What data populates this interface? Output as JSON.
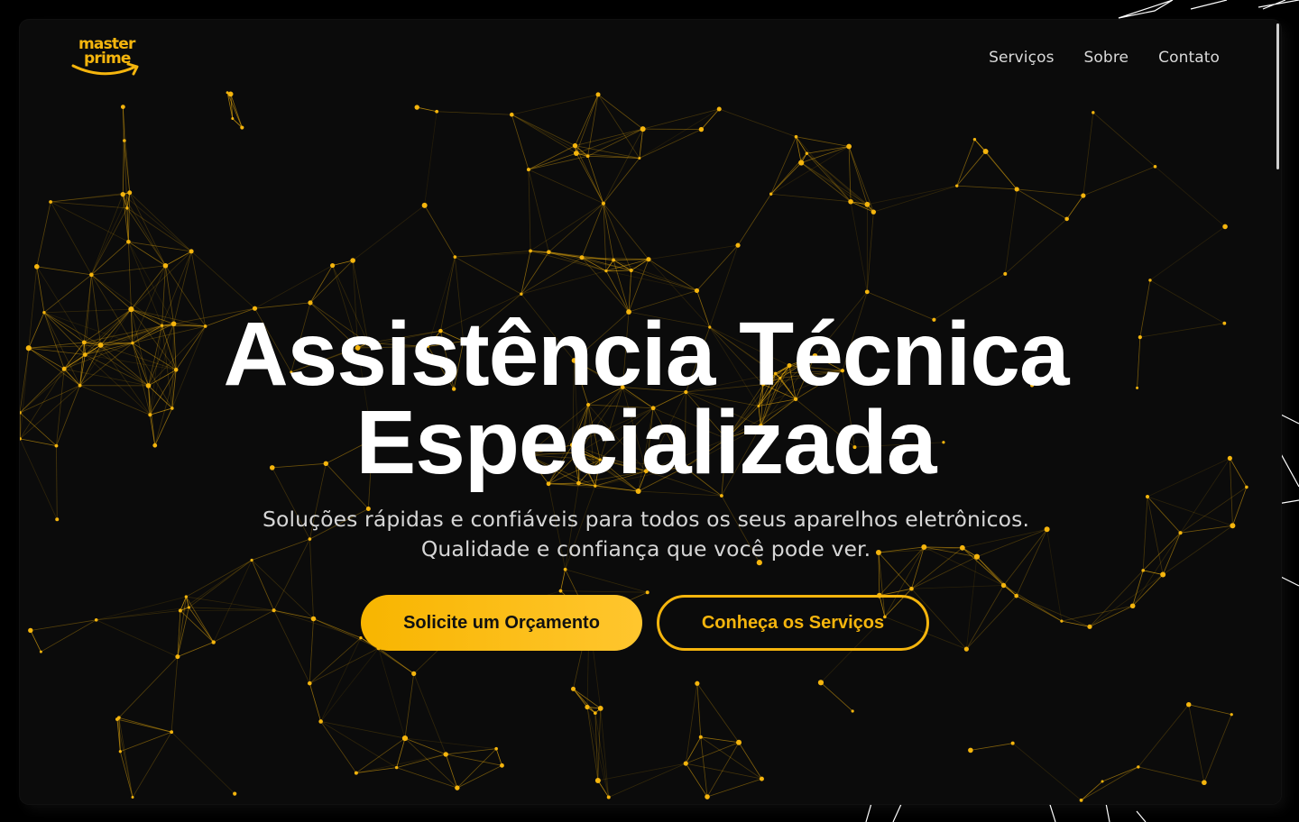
{
  "brand": {
    "logo_word1": "master",
    "logo_word2": "prime",
    "color": "#f5b50d"
  },
  "nav": {
    "items": [
      {
        "label": "Serviços"
      },
      {
        "label": "Sobre"
      },
      {
        "label": "Contato"
      }
    ]
  },
  "hero": {
    "title_line1": "Assistência Técnica",
    "title_line2": "Especializada",
    "subtitle_line1": "Soluções rápidas e confiáveis para todos os seus aparelhos eletrônicos.",
    "subtitle_line2": "Qualidade e confiança que você pode ver.",
    "primary_button": "Solicite um Orçamento",
    "secondary_button": "Conheça os Serviços"
  },
  "theme": {
    "accent": "#f5b50d",
    "background": "#0b0b0b"
  },
  "icons": {
    "logo_mark": "smile-arrow-icon",
    "background": "particle-network-icon"
  }
}
